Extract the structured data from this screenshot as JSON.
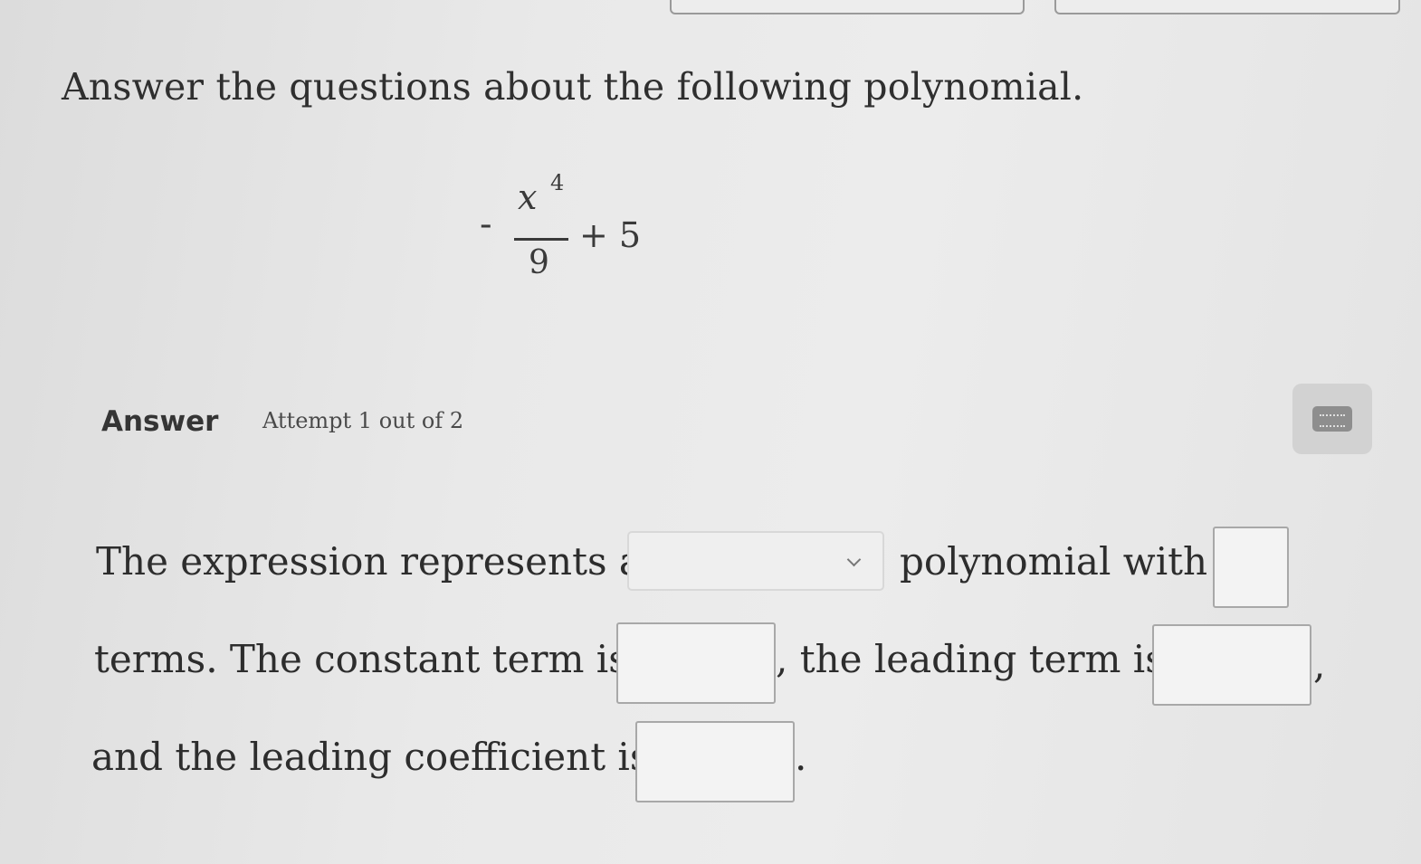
{
  "question": {
    "title": "Answer the questions about the following polynomial."
  },
  "expression": {
    "minus": "-",
    "numerator": "x",
    "exponent": "4",
    "denominator": "9",
    "plus_term": "+ 5"
  },
  "answer_header": {
    "label": "Answer",
    "attempt": "Attempt 1 out of 2"
  },
  "icons": {
    "keyboard": "keyboard-icon",
    "dropdown": "chevron-down-icon"
  },
  "sentence": {
    "part1": "The expression represents a",
    "part2": "polynomial with",
    "part3": "terms. The constant term is",
    "part4": ", the leading term is",
    "part5": ",",
    "part6": "and the leading coefficient is",
    "part7": "."
  },
  "fields": {
    "polynomial_type": "",
    "num_terms": "",
    "constant_term": "",
    "leading_term": "",
    "leading_coefficient": ""
  }
}
